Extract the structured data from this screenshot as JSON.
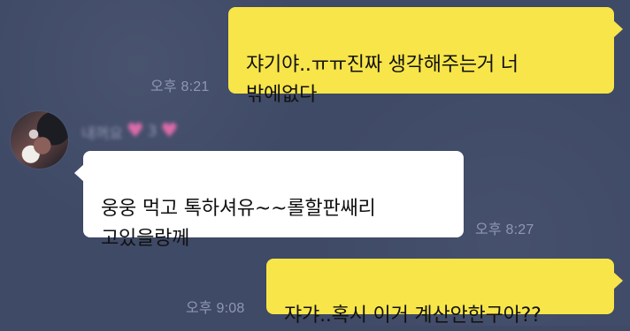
{
  "messages": [
    {
      "side": "outgoing",
      "text": "쟈기야..ㅠㅠ진짜 생각해주는거 너\n밖에없다",
      "time": "오후 8:21"
    },
    {
      "side": "incoming",
      "sender_name": "내꺼요",
      "sender_suffix": "3",
      "text": "웅웅 먹고 톡하셔유~~롤할판쌔리\n고있을랑께",
      "time": "오후 8:27"
    },
    {
      "side": "outgoing",
      "text": "쟈갸..혹시 이거 계산안한구아??",
      "time": "오후 9:08"
    }
  ]
}
